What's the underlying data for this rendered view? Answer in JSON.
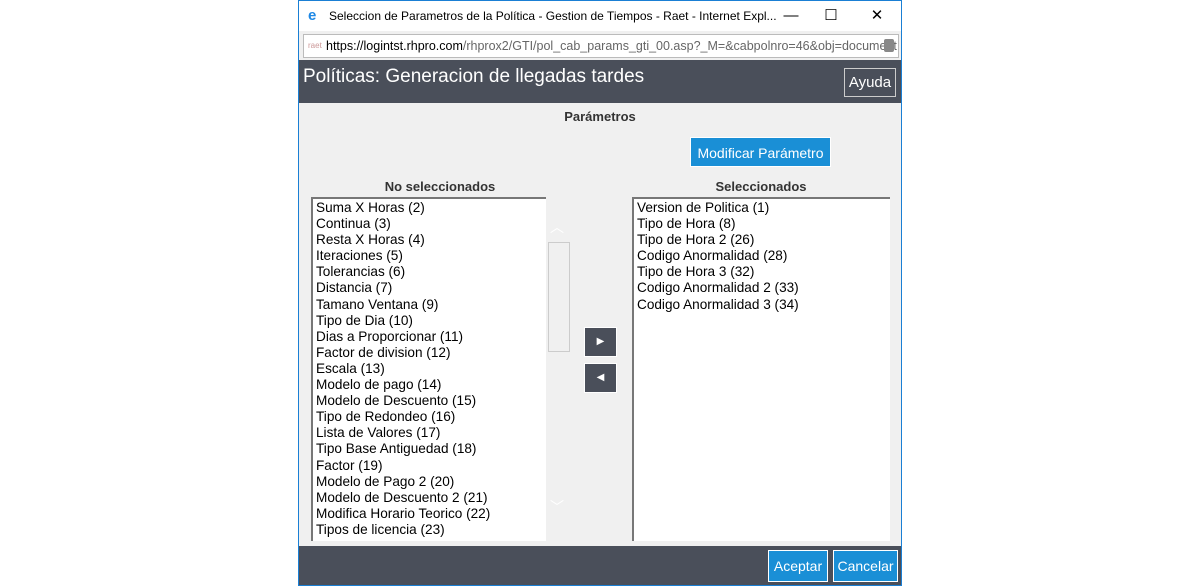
{
  "window": {
    "title": "Seleccion de Parametros de la Política - Gestion de Tiempos - Raet - Internet Expl...",
    "minimize": "—",
    "maximize": "☐",
    "close": "✕"
  },
  "address": {
    "favicon": "raet",
    "prefix": "https://logintst.",
    "domain": "rhpro.com",
    "path": "/rhprox2/GTI/pol_cab_params_gti_00.asp?_M=&cabpolnro=46&obj=document"
  },
  "header": {
    "title": "Políticas: Generacion de llegadas tardes",
    "help_label": "Ayuda"
  },
  "section_title": "Parámetros",
  "modify_label": "Modificar Parámetro",
  "left": {
    "label": "No seleccionados",
    "items": [
      "Suma X Horas (2)",
      "Continua (3)",
      "Resta X Horas (4)",
      "Iteraciones (5)",
      "Tolerancias (6)",
      "Distancia (7)",
      "Tamano Ventana (9)",
      "Tipo de Dia (10)",
      "Dias a Proporcionar (11)",
      "Factor de division (12)",
      "Escala (13)",
      "Modelo de pago (14)",
      "Modelo de Descuento (15)",
      "Tipo de Redondeo (16)",
      "Lista de Valores (17)",
      "Tipo Base Antiguedad (18)",
      "Factor (19)",
      "Modelo de Pago 2 (20)",
      "Modelo de Descuento 2 (21)",
      "Modifica Horario Teorico (22)",
      "Tipos de licencia (23)"
    ]
  },
  "right": {
    "label": "Seleccionados",
    "items": [
      "Version de Politica (1)",
      "Tipo de Hora (8)",
      "Tipo de Hora 2 (26)",
      "Codigo Anormalidad (28)",
      "Tipo de Hora 3 (32)",
      "Codigo Anormalidad 2 (33)",
      "Codigo Anormalidad 3 (34)"
    ]
  },
  "move": {
    "right": "▶",
    "left": "◀"
  },
  "footer": {
    "accept": "Aceptar",
    "cancel": "Cancelar"
  },
  "colors": {
    "header": "#4a4f5a",
    "accent": "#1a8fd6"
  }
}
